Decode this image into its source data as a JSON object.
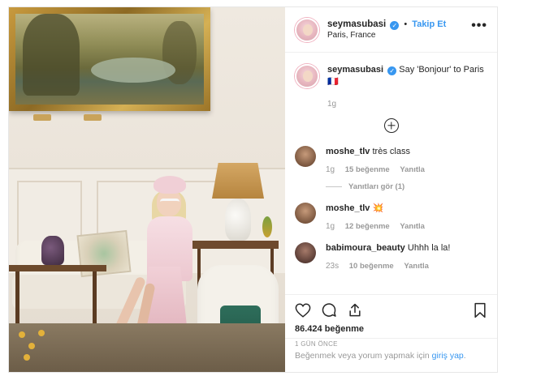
{
  "header": {
    "username": "seymasubasi",
    "separator": "•",
    "follow_label": "Takip Et",
    "location": "Paris, France",
    "verified_glyph": "✓",
    "more_glyph": "•••"
  },
  "caption": {
    "username": "seymasubasi",
    "text": "Say 'Bonjour' to Paris 🇫🇷",
    "time": "1g"
  },
  "comments": [
    {
      "username": "moshe_tlv",
      "text": "très class",
      "time": "1g",
      "likes": "15 beğenme",
      "reply_label": "Yanıtla",
      "view_replies": "Yanıtları gör (1)"
    },
    {
      "username": "moshe_tlv",
      "text": "💥",
      "time": "1g",
      "likes": "12 beğenme",
      "reply_label": "Yanıtla"
    },
    {
      "username": "babimoura_beauty",
      "text": "Uhhh la la!",
      "time": "23s",
      "likes": "10 beğenme",
      "reply_label": "Yanıtla"
    }
  ],
  "actions": {
    "icons": [
      "heart-icon",
      "comment-icon",
      "share-icon",
      "bookmark-icon"
    ],
    "likes_count": "86.424 beğenme",
    "posted_ago": "1 GÜN ÖNCE"
  },
  "login_bar": {
    "prefix": "Beğenmek veya yorum yapmak için",
    "link": "giriş yap",
    "suffix": "."
  },
  "colors": {
    "accent": "#3897f0",
    "text": "#262626",
    "muted": "#999999",
    "border": "#efefef"
  }
}
